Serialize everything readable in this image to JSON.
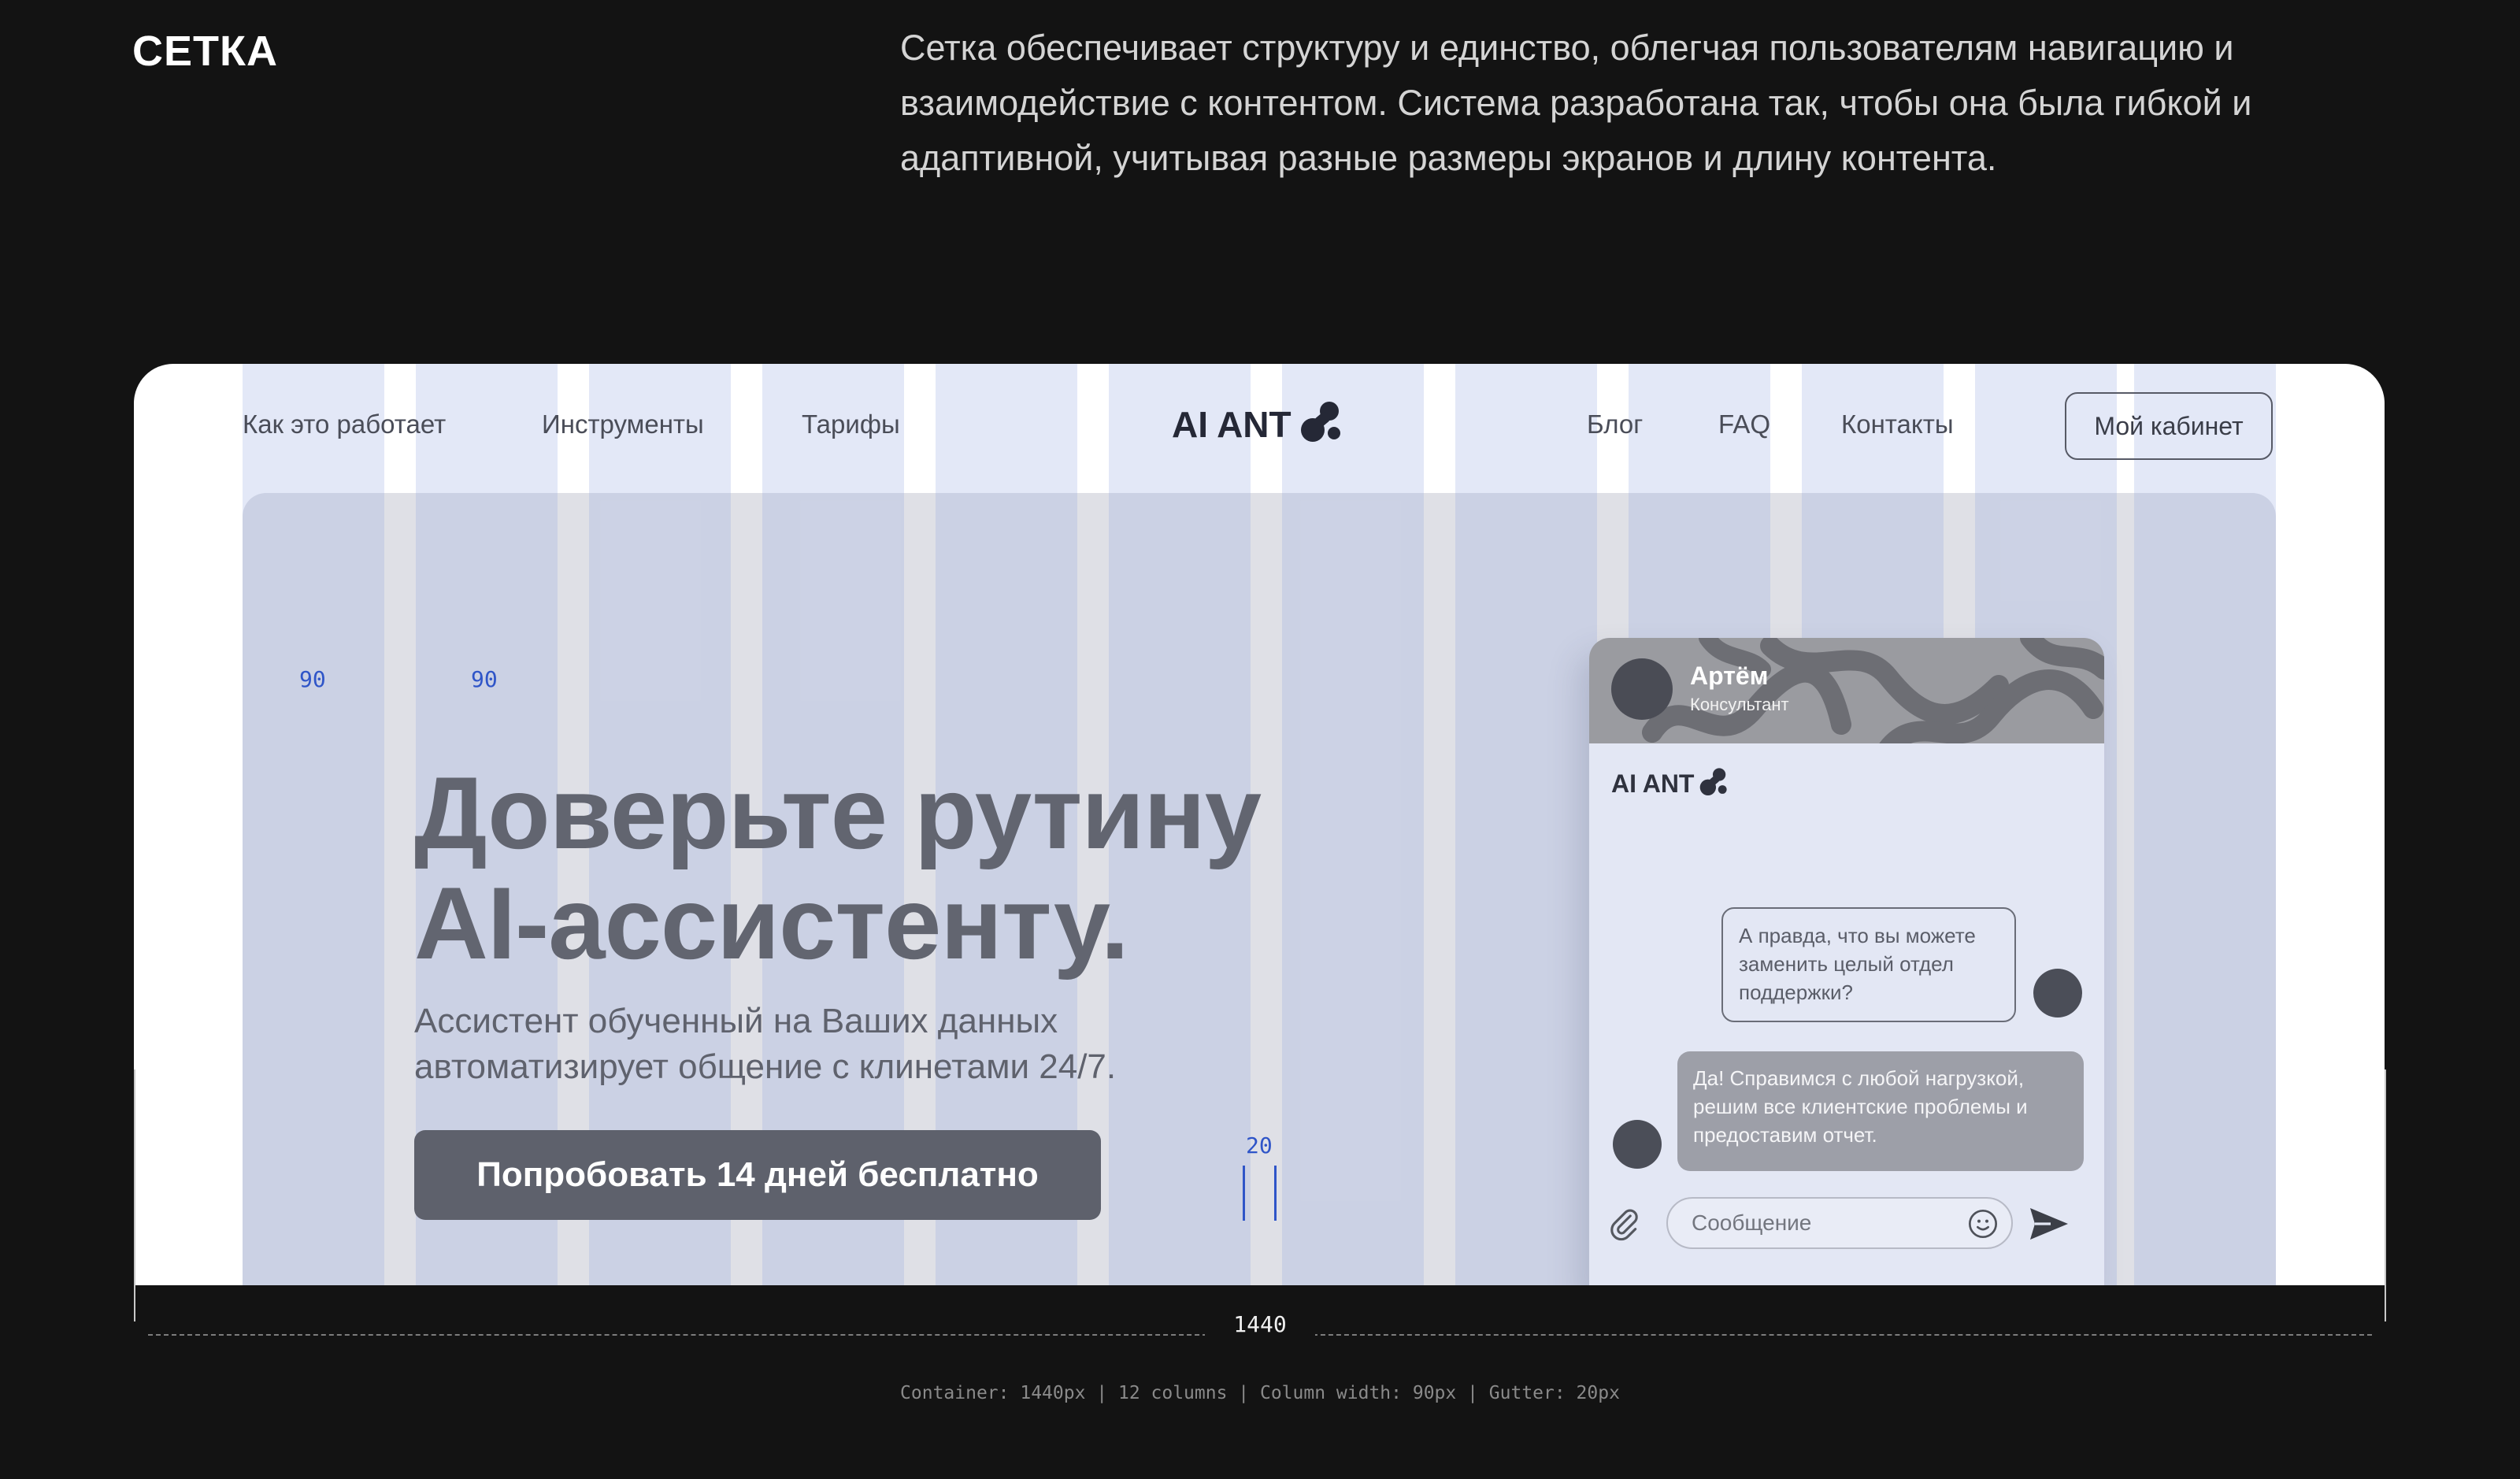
{
  "section": {
    "title": "СЕТКА",
    "intro": "Сетка обеспечивает структуру и единство, облегчая пользователям навигацию и взаимодействие с контентом. Система разработана так, чтобы она была гибкой и адаптивной, учитывая разные размеры экранов и длину контента."
  },
  "nav": {
    "left": [
      "Как это работает",
      "Инструменты",
      "Тарифы"
    ],
    "brand": "AI ANT",
    "right": [
      "Блог",
      "FAQ",
      "Контакты"
    ],
    "cabinet_button": "Мой кабинет"
  },
  "hero": {
    "headline_line1": "Доверьте рутину",
    "headline_line2": "AI-ассистенту.",
    "subtext_line1": "Ассистент обученный на Ваших данных",
    "subtext_line2": "автоматизирует общение с клинетами 24/7.",
    "cta": "Попробовать 14 дней бесплатно"
  },
  "chat": {
    "agent_name": "Артём",
    "agent_role": "Консультант",
    "brand": "AI ANT",
    "user_message": "А правда, что вы можете заменить целый отдел поддержки?",
    "bot_message": "Да! Справимся с любой нагрузкой, решим все клиентские проблемы и предоставим отчет.",
    "input_placeholder": "Сообщение"
  },
  "annotations": {
    "column_width_label": "90",
    "column_width_label_2": "90",
    "gutter_label": "20",
    "container_width_label": "1440",
    "caption": "Container: 1440px | 12 columns | Column width: 90px | Gutter: 20px"
  },
  "icons": {
    "logo": "ant-logo-icon",
    "attach": "paperclip-icon",
    "emoji": "smiley-icon",
    "send": "send-arrow-icon"
  },
  "colors": {
    "page_background": "#131313",
    "frame": "#ffffff",
    "hero_background": "#dfe0e6",
    "grid_overlay": "#94a8e2",
    "measure_accent": "#2f55c8",
    "cta": "#5e616c"
  }
}
